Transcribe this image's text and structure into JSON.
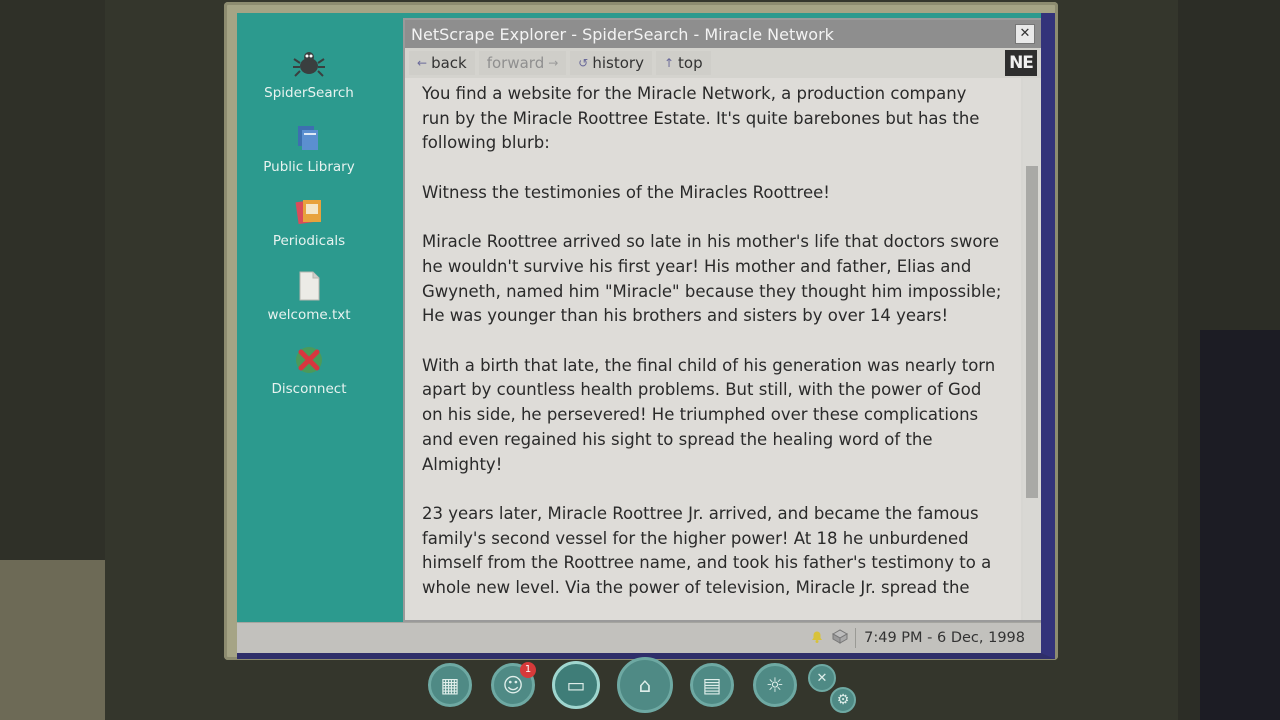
{
  "desktop": {
    "icons": [
      {
        "label": "SpiderSearch",
        "icon": "spider-icon"
      },
      {
        "label": "Public Library",
        "icon": "books-icon"
      },
      {
        "label": "Periodicals",
        "icon": "magazine-icon"
      },
      {
        "label": "welcome.txt",
        "icon": "text-file-icon"
      },
      {
        "label": "Disconnect",
        "icon": "disconnect-icon"
      }
    ]
  },
  "window": {
    "title": "NetScrape Explorer - SpiderSearch - Miracle Network",
    "close_label": "✕",
    "logo": "NE"
  },
  "toolbar": {
    "back_label": "back",
    "forward_label": "forward",
    "history_label": "history",
    "top_label": "top"
  },
  "page": {
    "paragraphs": [
      "You find a website for the Miracle Network, a production company\nrun by the Miracle Roottree Estate. It's quite barebones but has the\nfollowing blurb:",
      "Witness the testimonies of the Miracles Roottree!",
      "Miracle Roottree arrived so late in his mother's life that doctors swore\nhe wouldn't survive his first year! His mother and father, Elias and\nGwyneth, named him \"Miracle\" because they thought him impossible;\nHe was younger than his brothers and sisters by over 14 years!",
      "With a birth that late, the final child of his generation was nearly torn\napart by countless health problems. But still, with the power of God\non his side, he persevered! He triumphed over these complications\nand even regained his sight to spread the healing word of the\nAlmighty!",
      "23 years later, Miracle Roottree Jr. arrived, and became the famous\nfamily's second vessel for the higher power! At 18 he unburdened\nhimself from the Roottree name, and took his father's testimony to a\nwhole new level. Via the power of television, Miracle Jr. spread the"
    ]
  },
  "taskbar": {
    "time": "7:49 PM - 6 Dec, 1998",
    "tray_icons": [
      "bell-icon",
      "network-icon"
    ]
  },
  "dock": {
    "buttons": [
      {
        "icon": "cabinet-icon",
        "badge": ""
      },
      {
        "icon": "contacts-icon",
        "badge": "1"
      },
      {
        "icon": "computer-icon",
        "badge": ""
      },
      {
        "icon": "home-icon",
        "badge": ""
      },
      {
        "icon": "notes-icon",
        "badge": ""
      },
      {
        "icon": "meditate-icon",
        "badge": ""
      },
      {
        "icon": "settings-icon",
        "badge": ""
      }
    ]
  },
  "colors": {
    "desktop_bg": "#2c9a8e",
    "titlebar": "#8e8e8e",
    "page_bg": "#dedcd8"
  }
}
